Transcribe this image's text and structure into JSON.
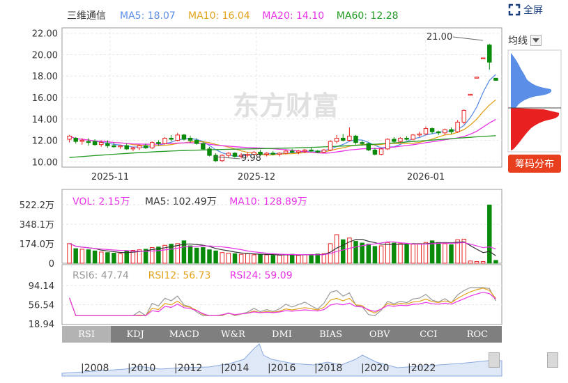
{
  "stock": {
    "name": "三维通信"
  },
  "main_legend": [
    {
      "label": "MA5: 18.07",
      "color": "#5b8ee6"
    },
    {
      "label": "MA10: 16.04",
      "color": "#e3a21a"
    },
    {
      "label": "MA20: 14.10",
      "color": "#e832e8"
    },
    {
      "label": "MA60: 12.28",
      "color": "#229922"
    }
  ],
  "toolbar": {
    "fullscreen_label": "全屏",
    "avg_label": "均线",
    "chip_button": "筹码分布"
  },
  "main_chart": {
    "y_ticks": [
      "22.00",
      "20.00",
      "18.00",
      "16.00",
      "14.00",
      "12.00",
      "10.00"
    ],
    "x_ticks": [
      "2025-11",
      "2025-12",
      "2026-01"
    ],
    "high_marker": "21.00",
    "low_marker": "9.98",
    "watermark": "东方财富"
  },
  "vol_chart": {
    "legend": [
      {
        "label": "VOL: 2.15万",
        "color": "#e832e8"
      },
      {
        "label": "MA5: 102.49万",
        "color": "#333333"
      },
      {
        "label": "MA10: 128.89万",
        "color": "#e832e8"
      }
    ],
    "y_ticks": [
      "522.2万",
      "348.1万",
      "174.0万",
      "0"
    ]
  },
  "rsi_chart": {
    "legend": [
      {
        "label": "RSI6: 47.74",
        "color": "#999999"
      },
      {
        "label": "RSI12: 56.73",
        "color": "#e3a21a"
      },
      {
        "label": "RSI24: 59.09",
        "color": "#e832e8"
      }
    ],
    "y_ticks": [
      "94.14",
      "56.54",
      "18.94"
    ]
  },
  "indicator_tabs": [
    "RSI",
    "KDJ",
    "MACD",
    "W&R",
    "DMI",
    "BIAS",
    "OBV",
    "CCI",
    "ROC"
  ],
  "active_tab": "RSI",
  "range_years": [
    "|2008",
    "|2010",
    "|2012",
    "|2014",
    "|2016",
    "|2018",
    "|2020",
    "|2022"
  ],
  "colors": {
    "up": "#e8201f",
    "down": "#0a8a0a",
    "accent": "#e8401f"
  },
  "chart_data": {
    "type": "candlestick",
    "title": "三维通信",
    "x_ticks": [
      "2025-11",
      "2025-12",
      "2026-01"
    ],
    "ylim": [
      9.5,
      22.5
    ],
    "candles": [
      [
        12.1,
        12.5,
        11.8,
        12.4
      ],
      [
        12.2,
        12.3,
        11.7,
        11.9
      ],
      [
        11.9,
        12.2,
        11.6,
        12.0
      ],
      [
        11.9,
        12.2,
        11.5,
        11.8
      ],
      [
        11.9,
        12.1,
        11.5,
        11.6
      ],
      [
        11.6,
        12.0,
        11.4,
        11.8
      ],
      [
        11.7,
        12.0,
        11.3,
        11.5
      ],
      [
        11.5,
        11.8,
        11.3,
        11.4
      ],
      [
        11.4,
        11.6,
        11.2,
        11.5
      ],
      [
        11.5,
        11.7,
        11.1,
        11.2
      ],
      [
        11.2,
        11.4,
        11.0,
        11.3
      ],
      [
        11.3,
        11.6,
        11.1,
        11.5
      ],
      [
        11.5,
        11.7,
        11.2,
        11.3
      ],
      [
        11.3,
        11.9,
        11.2,
        11.8
      ],
      [
        11.8,
        12.0,
        11.5,
        11.7
      ],
      [
        11.7,
        12.3,
        11.6,
        12.2
      ],
      [
        12.2,
        12.5,
        11.9,
        12.1
      ],
      [
        12.0,
        12.7,
        11.9,
        12.5
      ],
      [
        12.5,
        12.6,
        12.0,
        12.1
      ],
      [
        12.2,
        12.4,
        11.8,
        12.0
      ],
      [
        12.0,
        12.2,
        11.6,
        11.7
      ],
      [
        11.7,
        11.9,
        11.1,
        11.2
      ],
      [
        11.2,
        11.4,
        10.5,
        10.6
      ],
      [
        10.6,
        10.8,
        9.98,
        10.1
      ],
      [
        10.1,
        10.7,
        10.0,
        10.6
      ],
      [
        10.6,
        10.9,
        10.4,
        10.8
      ],
      [
        10.8,
        10.9,
        10.4,
        10.5
      ],
      [
        10.5,
        10.8,
        10.3,
        10.6
      ],
      [
        10.6,
        10.9,
        10.4,
        10.7
      ],
      [
        10.7,
        11.0,
        10.5,
        10.9
      ],
      [
        10.9,
        11.1,
        10.6,
        10.7
      ],
      [
        10.7,
        10.9,
        10.5,
        10.8
      ],
      [
        10.8,
        11.0,
        10.6,
        10.7
      ],
      [
        10.7,
        10.9,
        10.5,
        10.8
      ],
      [
        10.8,
        11.1,
        10.7,
        11.0
      ],
      [
        11.0,
        11.2,
        10.8,
        10.9
      ],
      [
        10.9,
        11.1,
        10.7,
        11.0
      ],
      [
        11.0,
        11.2,
        10.8,
        11.1
      ],
      [
        11.1,
        11.3,
        10.9,
        11.0
      ],
      [
        11.0,
        11.1,
        10.8,
        10.9
      ],
      [
        10.9,
        11.2,
        10.8,
        11.1
      ],
      [
        11.1,
        12.0,
        11.0,
        11.9
      ],
      [
        11.9,
        12.5,
        11.7,
        12.2
      ],
      [
        12.2,
        12.6,
        11.9,
        12.0
      ],
      [
        12.0,
        13.2,
        11.9,
        12.4
      ],
      [
        12.4,
        12.5,
        11.6,
        11.8
      ],
      [
        11.8,
        12.0,
        11.5,
        11.7
      ],
      [
        11.7,
        11.8,
        11.0,
        11.1
      ],
      [
        11.1,
        11.3,
        10.6,
        10.7
      ],
      [
        10.7,
        11.3,
        10.6,
        11.2
      ],
      [
        11.2,
        12.2,
        11.1,
        12.1
      ],
      [
        12.1,
        12.3,
        11.8,
        11.9
      ],
      [
        11.9,
        12.3,
        11.8,
        12.2
      ],
      [
        12.2,
        12.4,
        12.0,
        12.1
      ],
      [
        12.1,
        12.6,
        12.0,
        12.5
      ],
      [
        12.5,
        12.8,
        12.3,
        12.6
      ],
      [
        12.6,
        13.3,
        12.5,
        13.1
      ],
      [
        13.1,
        13.2,
        12.6,
        12.8
      ],
      [
        12.8,
        12.9,
        12.5,
        12.7
      ],
      [
        12.7,
        13.1,
        12.5,
        13.0
      ],
      [
        13.0,
        13.2,
        12.6,
        12.8
      ],
      [
        12.8,
        13.9,
        12.7,
        13.7
      ],
      [
        13.7,
        14.9,
        13.5,
        14.8
      ],
      [
        16.3,
        16.3,
        16.3,
        16.3
      ],
      [
        17.9,
        17.9,
        17.9,
        17.9
      ],
      [
        19.7,
        19.7,
        19.7,
        19.7
      ],
      [
        20.9,
        21.0,
        18.6,
        19.3
      ],
      [
        17.8,
        17.8,
        17.6,
        17.6
      ]
    ],
    "volumes": [
      175,
      130,
      125,
      120,
      110,
      100,
      95,
      90,
      85,
      110,
      115,
      120,
      125,
      140,
      145,
      160,
      170,
      175,
      200,
      155,
      135,
      140,
      120,
      110,
      95,
      90,
      85,
      80,
      85,
      75,
      80,
      75,
      70,
      72,
      78,
      80,
      70,
      75,
      78,
      82,
      85,
      175,
      255,
      210,
      225,
      195,
      180,
      170,
      150,
      155,
      185,
      180,
      175,
      165,
      170,
      175,
      185,
      200,
      185,
      175,
      165,
      210,
      215,
      20,
      15,
      15,
      520,
      25
    ],
    "series": [
      {
        "name": "MA5"
      },
      {
        "name": "MA10"
      },
      {
        "name": "MA20"
      },
      {
        "name": "MA60"
      }
    ]
  }
}
